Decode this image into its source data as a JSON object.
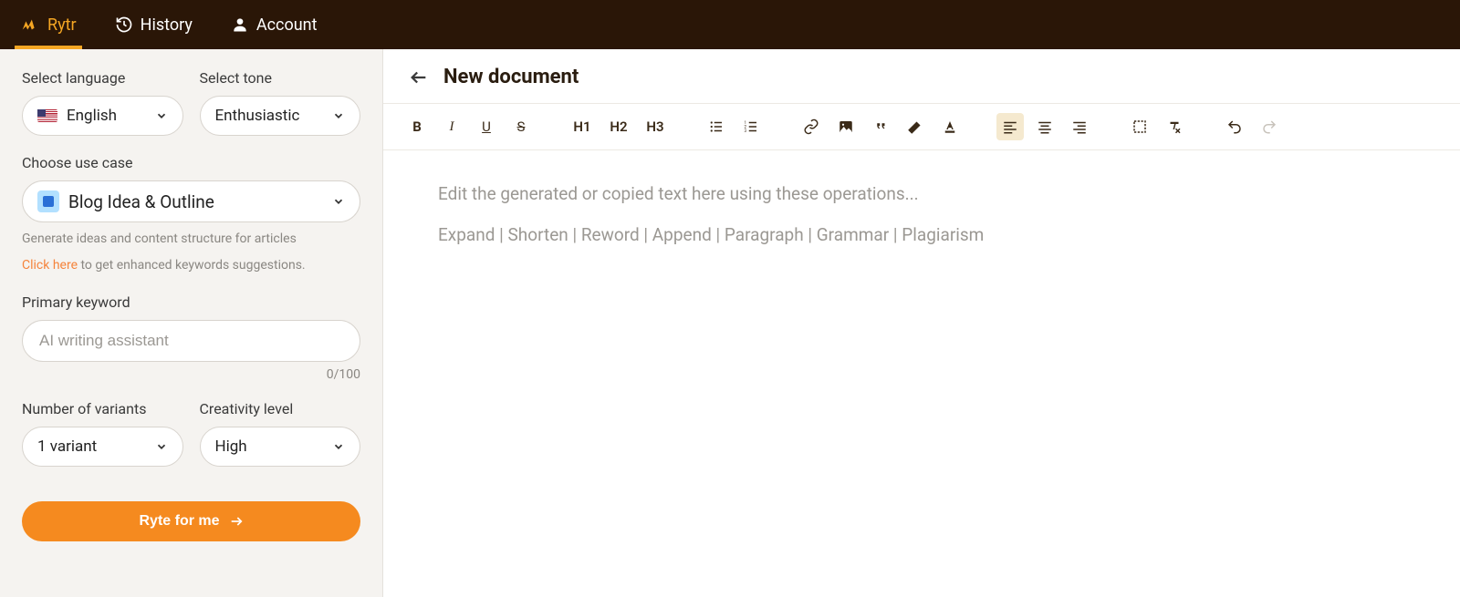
{
  "nav": {
    "rytr": "Rytr",
    "history": "History",
    "account": "Account"
  },
  "sidebar": {
    "language_label": "Select language",
    "language_value": "English",
    "tone_label": "Select tone",
    "tone_value": "Enthusiastic",
    "usecase_label": "Choose use case",
    "usecase_value": "Blog Idea & Outline",
    "usecase_helper": "Generate ideas and content structure for articles",
    "click_here": "Click here",
    "keyword_helper_suffix": " to get enhanced keywords suggestions.",
    "keyword_label": "Primary keyword",
    "keyword_placeholder": "AI writing assistant",
    "keyword_counter": "0/100",
    "variants_label": "Number of variants",
    "variants_value": "1 variant",
    "creativity_label": "Creativity level",
    "creativity_value": "High",
    "ryte_button": "Ryte for me"
  },
  "doc": {
    "title": "New document"
  },
  "toolbar": {
    "bold": "B",
    "italic": "I",
    "underline": "U",
    "strike": "S",
    "h1": "H1",
    "h2": "H2",
    "h3": "H3"
  },
  "editor": {
    "placeholder_line1": "Edit the generated or copied text here using these operations...",
    "placeholder_line2": "Expand | Shorten | Reword | Append | Paragraph | Grammar | Plagiarism"
  }
}
